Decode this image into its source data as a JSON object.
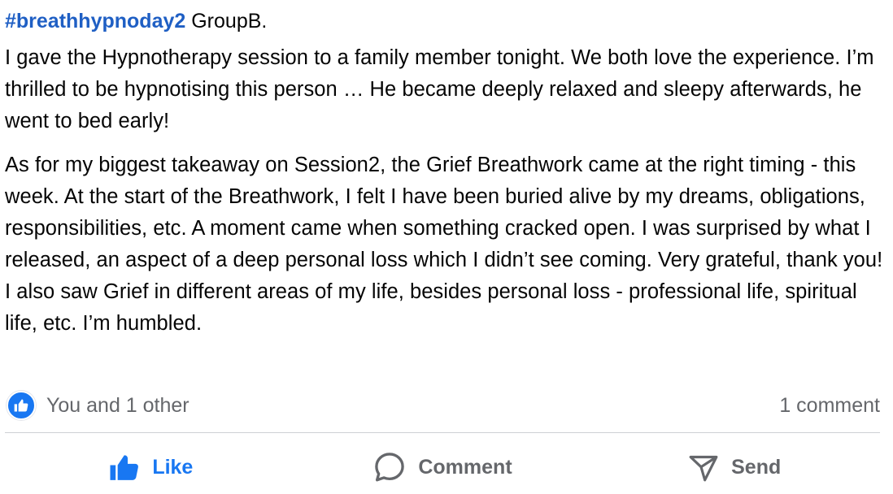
{
  "post": {
    "hashtag": "#breathhypnoday2",
    "group": "GroupB.",
    "paragraphs": [
      "I gave the Hypnotherapy session to a family member tonight. We both love the experience. I’m thrilled to be hypnotising this person … He became deeply relaxed and sleepy afterwards, he went to bed early!",
      "As for my biggest takeaway on Session2, the Grief Breathwork came at the right timing - this week. At the start of the Breathwork, I felt I have been buried alive by my dreams, obligations, responsibilities, etc. A moment came when something cracked open. I was surprised by what I released, an aspect of a deep personal loss which I didn’t see coming. Very grateful, thank you! I also saw Grief in different areas of my life, besides personal loss - professional life, spiritual life, etc. I’m humbled."
    ]
  },
  "reactions": {
    "summary": "You and 1 other",
    "icon": "like-reaction-icon",
    "comments": "1 comment"
  },
  "actions": {
    "like": {
      "label": "Like",
      "icon": "thumbs-up-icon",
      "active": true
    },
    "comment": {
      "label": "Comment",
      "icon": "speech-bubble-icon"
    },
    "send": {
      "label": "Send",
      "icon": "paper-plane-icon"
    }
  },
  "colors": {
    "accent": "#1877f2",
    "hashtag": "#1f5fc4",
    "secondary_text": "#65676b",
    "divider": "#ced0d4"
  }
}
